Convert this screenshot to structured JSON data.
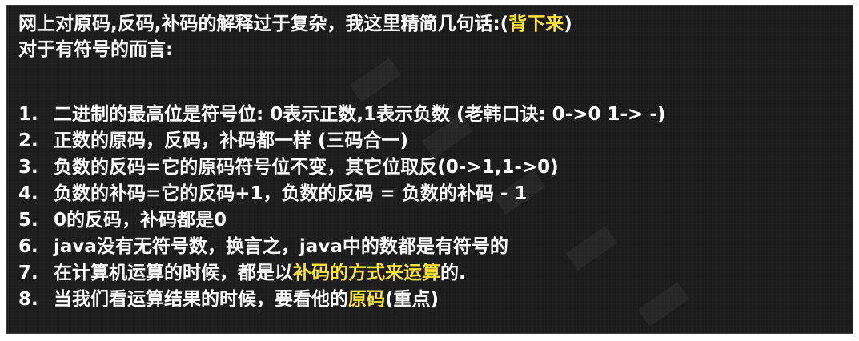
{
  "header": {
    "line1_text": "网上对原码,反码,补码的解释过于复杂，我这里精简几句话:(",
    "line1_highlight": "背下来",
    "line1_close": ")",
    "line2_text": "对于有符号的而言:"
  },
  "rules": [
    {
      "num": "1.",
      "text": "二进制的最高位是符号位: 0表示正数,1表示负数 (老韩口诀: 0->0 1-> -)"
    },
    {
      "num": "2.",
      "text": "正数的原码，反码，补码都一样 (三码合一)"
    },
    {
      "num": "3.",
      "text": "负数的反码=它的原码符号位不变，其它位取反(0->1,1->0)"
    },
    {
      "num": "4.",
      "text": "负数的补码=它的反码+1，负数的反码 =  负数的补码 - 1"
    },
    {
      "num": "5.",
      "text": "0的反码，补码都是0"
    },
    {
      "num": "6.",
      "text": "java没有无符号数，换言之，java中的数都是有符号的"
    },
    {
      "num": "7.",
      "text_before": "在计算机运算的时候，都是以",
      "highlight": "补码的方式来运算",
      "text_after": "的."
    },
    {
      "num": "8.",
      "text_before": "当我们看运算结果的时候，要看他的",
      "highlight": "原码",
      "text_after": "(重点)"
    }
  ],
  "colors": {
    "background": "#1b1b1b",
    "text": "#ffffff",
    "highlight": "#ffe33a"
  }
}
